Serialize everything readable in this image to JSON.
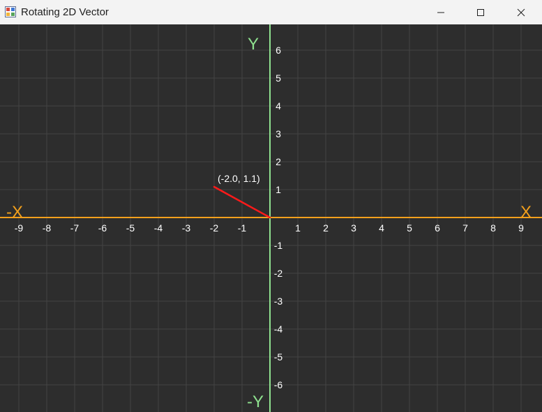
{
  "window": {
    "title": "Rotating 2D Vector",
    "icon": "app-window-icon",
    "controls": {
      "minimize": "minimize-icon",
      "maximize": "maximize-icon",
      "close": "close-icon"
    }
  },
  "colors": {
    "background": "#2d2d2d",
    "grid": "#434343",
    "x_axis": "#f3a01c",
    "y_axis": "#8fe28f",
    "vector": "#ff1a1a",
    "tick_text": "#ffffff"
  },
  "chart_data": {
    "type": "scatter",
    "title": "",
    "xlim": [
      -9.7,
      9.7
    ],
    "ylim": [
      -6.9,
      6.9
    ],
    "x_ticks": [
      -9,
      -8,
      -7,
      -6,
      -5,
      -4,
      -3,
      -2,
      -1,
      1,
      2,
      3,
      4,
      5,
      6,
      7,
      8,
      9
    ],
    "y_ticks": [
      6,
      5,
      4,
      3,
      2,
      1,
      -1,
      -2,
      -3,
      -4,
      -5,
      -6
    ],
    "axis_labels": {
      "x_pos": "X",
      "x_neg": "-X",
      "y_pos": "Y",
      "y_neg": "-Y"
    },
    "grid": true,
    "vector": {
      "from": [
        0,
        0
      ],
      "to": [
        -2.0,
        1.1
      ],
      "label": "(-2.0, 1.1)"
    }
  }
}
